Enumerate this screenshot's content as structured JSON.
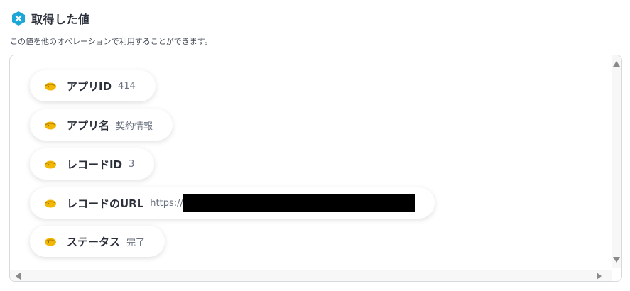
{
  "header": {
    "title": "取得した値",
    "icon": "kintone-logo-icon"
  },
  "description": "この値を他のオペレーションで利用することができます。",
  "values": [
    {
      "label": "アプリID",
      "value": "414",
      "icon": "kintone-bird-icon"
    },
    {
      "label": "アプリ名",
      "value": "契約情報",
      "icon": "kintone-bird-icon"
    },
    {
      "label": "レコードID",
      "value": "3",
      "icon": "kintone-bird-icon"
    },
    {
      "label": "レコードのURL",
      "value": "https://",
      "icon": "kintone-bird-icon",
      "redacted": true
    },
    {
      "label": "ステータス",
      "value": "完了",
      "icon": "kintone-bird-icon"
    }
  ],
  "colors": {
    "logo": "#1aa6d6",
    "chip_icon": "#f2b705",
    "text": "#2a2f3a",
    "muted": "#6b7280"
  }
}
